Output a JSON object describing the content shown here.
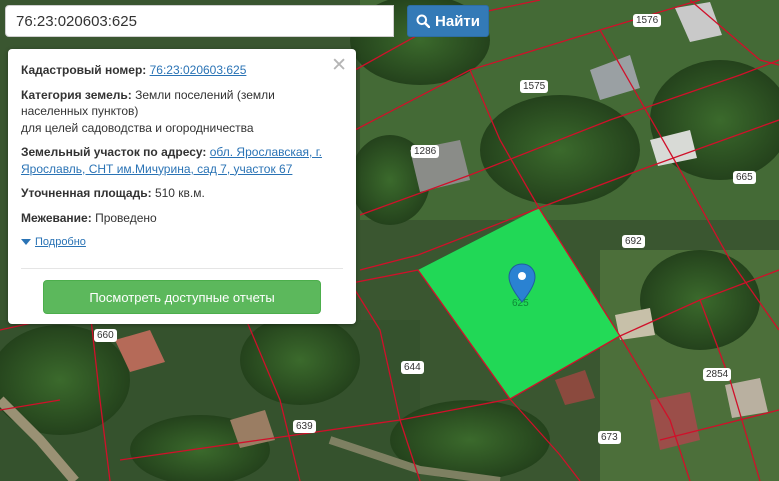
{
  "search": {
    "query": "76:23:020603:625",
    "button_label": "Найти"
  },
  "info": {
    "cadastral_label": "Кадастровый номер:",
    "cadastral_number": "76:23:020603:625",
    "category_label": "Категория земель:",
    "category_value": "Земли поселений (земли населенных пунктов)",
    "category_purpose": "для целей садоводства и огородничества",
    "address_label": "Земельный участок по адресу:",
    "address_value": "обл. Ярославская, г. Ярославль, СНТ им.Мичурина, сад 7, участок 67",
    "area_label": "Уточненная площадь:",
    "area_value": "510 кв.м.",
    "survey_label": "Межевание:",
    "survey_value": "Проведено",
    "more_link": "Подробно",
    "reports_button": "Посмотреть доступные отчеты",
    "close_symbol": "✕"
  },
  "map": {
    "parcel_labels": [
      "1576",
      "1575",
      "1286",
      "665",
      "692",
      "625",
      "660",
      "644",
      "2854",
      "639",
      "673"
    ],
    "highlight_color": "#1fe35a",
    "boundary_color": "#d0102a"
  },
  "icons": {
    "search": "search-icon",
    "pin": "map-pin-icon",
    "expand": "triangle-down-icon",
    "close": "close-icon"
  }
}
